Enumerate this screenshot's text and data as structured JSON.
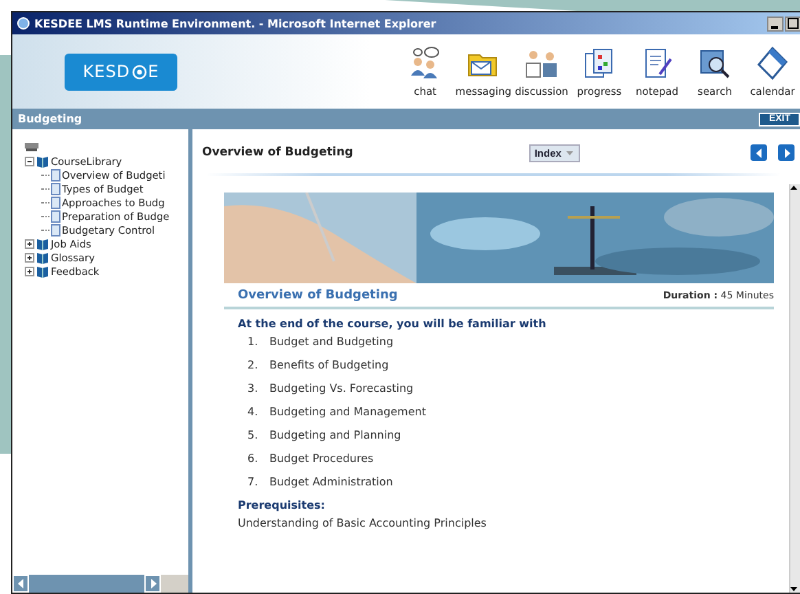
{
  "window": {
    "title": "KESDEE LMS Runtime Environment. - Microsoft Internet Explorer"
  },
  "logo": {
    "left": "KESD",
    "right": "E"
  },
  "toolbar": [
    {
      "label": "chat",
      "kind": "chat"
    },
    {
      "label": "messaging",
      "kind": "messaging"
    },
    {
      "label": "discussion",
      "kind": "discussion"
    },
    {
      "label": "progress",
      "kind": "progress"
    },
    {
      "label": "notepad",
      "kind": "notepad"
    },
    {
      "label": "search",
      "kind": "search"
    },
    {
      "label": "calendar",
      "kind": "calendar"
    }
  ],
  "course_bar": {
    "title": "Budgeting",
    "exit": "EXIT"
  },
  "tree": [
    {
      "label": "CourseLibrary",
      "expanded": true,
      "children": [
        {
          "label": "Overview of Budgeti"
        },
        {
          "label": "Types of Budget"
        },
        {
          "label": "Approaches to Budg"
        },
        {
          "label": "Preparation of Budge"
        },
        {
          "label": "Budgetary Control"
        }
      ]
    },
    {
      "label": "Job Aids",
      "expanded": false
    },
    {
      "label": "Glossary",
      "expanded": false
    },
    {
      "label": "Feedback",
      "expanded": false
    }
  ],
  "content": {
    "page_title": "Overview of Budgeting",
    "index_button": "Index",
    "heading": "Overview of Budgeting",
    "duration_label": "Duration :",
    "duration": "45 Minutes",
    "intro": "At the end of the course, you will be familiar with",
    "topics": [
      {
        "number": "1.",
        "text": "Budget and Budgeting"
      },
      {
        "number": "2.",
        "text": "Benefits of Budgeting"
      },
      {
        "number": "3.",
        "text": "Budgeting Vs. Forecasting"
      },
      {
        "number": "4.",
        "text": "Budgeting and Management"
      },
      {
        "number": "5.",
        "text": "Budgeting and Planning"
      },
      {
        "number": "6.",
        "text": "Budget Procedures"
      },
      {
        "number": "7.",
        "text": "Budget Administration"
      }
    ],
    "prerequisites_label": "Prerequisites:",
    "prerequisites": "Understanding of Basic Accounting Principles"
  }
}
